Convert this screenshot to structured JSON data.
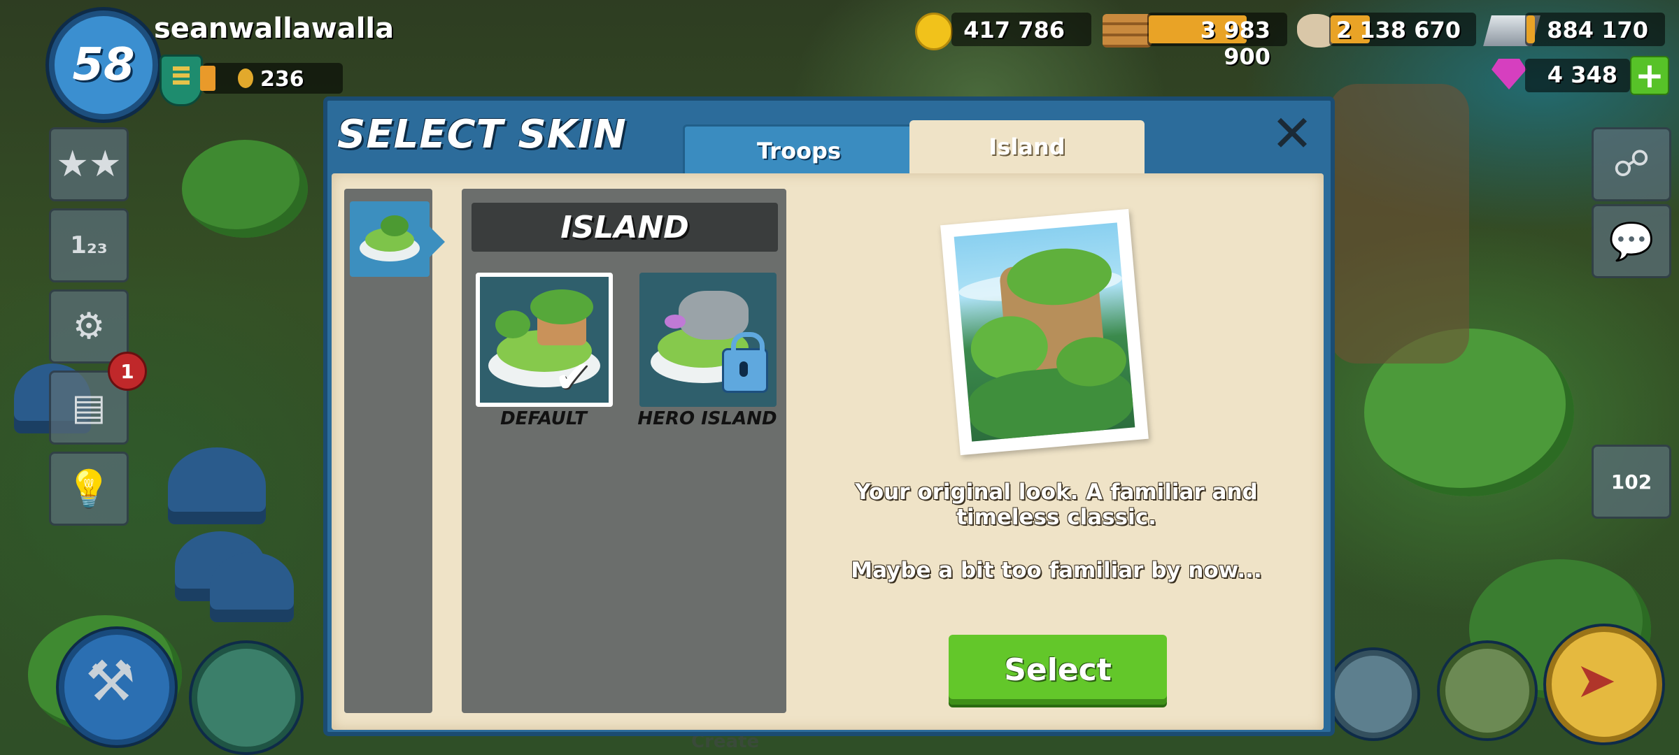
{
  "player": {
    "level": "58",
    "name": "seanwallawalla",
    "victory_points": "236"
  },
  "resources": {
    "gold": "417 786",
    "wood": "3 983 900",
    "stone": "2 138 670",
    "iron": "884 170",
    "diamonds": "4 348"
  },
  "notifications": {
    "news_badge": "1"
  },
  "right_side": {
    "gems_counter": "102"
  },
  "dialog": {
    "title": "SELECT SKIN",
    "tabs": [
      {
        "label": "Troops",
        "active": false
      },
      {
        "label": "Island",
        "active": true
      }
    ],
    "category_header": "ISLAND",
    "skins": [
      {
        "label": "DEFAULT",
        "selected": true,
        "locked": false
      },
      {
        "label": "HERO ISLAND",
        "selected": false,
        "locked": true
      }
    ],
    "description_line1": "Your original look. A familiar and timeless classic.",
    "description_line2": "Maybe a bit too familiar by now...",
    "select_label": "Select"
  },
  "background_text": {
    "create_label": "Create"
  },
  "colors": {
    "dialog_blue": "#2c6c9b",
    "parchment": "#efe3c7",
    "select_green": "#63c72a",
    "resource_fill": "#e9a326"
  }
}
